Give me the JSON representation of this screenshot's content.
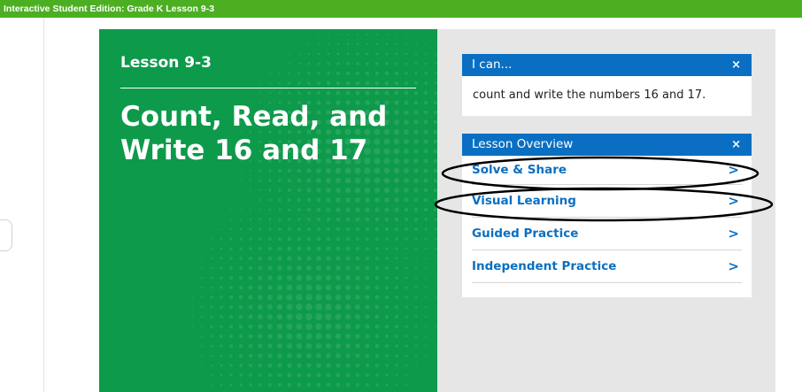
{
  "header": {
    "title": "Interactive Student Edition: Grade K Lesson 9-3"
  },
  "cover": {
    "lesson_label": "Lesson 9-3",
    "title_line1": "Count, Read, and",
    "title_line2": "Write 16 and 17"
  },
  "ican": {
    "heading": "I can...",
    "close_label": "×",
    "body": "count and write the numbers 16 and 17."
  },
  "overview": {
    "heading": "Lesson Overview",
    "close_label": "×",
    "chevron": ">",
    "items": [
      {
        "label": "Solve & Share"
      },
      {
        "label": "Visual Learning"
      },
      {
        "label": "Guided Practice"
      },
      {
        "label": "Independent Practice"
      }
    ]
  },
  "colors": {
    "topbar": "#4caf22",
    "cover_green": "#0d9a4b",
    "header_blue": "#0a6fc2",
    "panel_gray": "#e6e6e6"
  }
}
